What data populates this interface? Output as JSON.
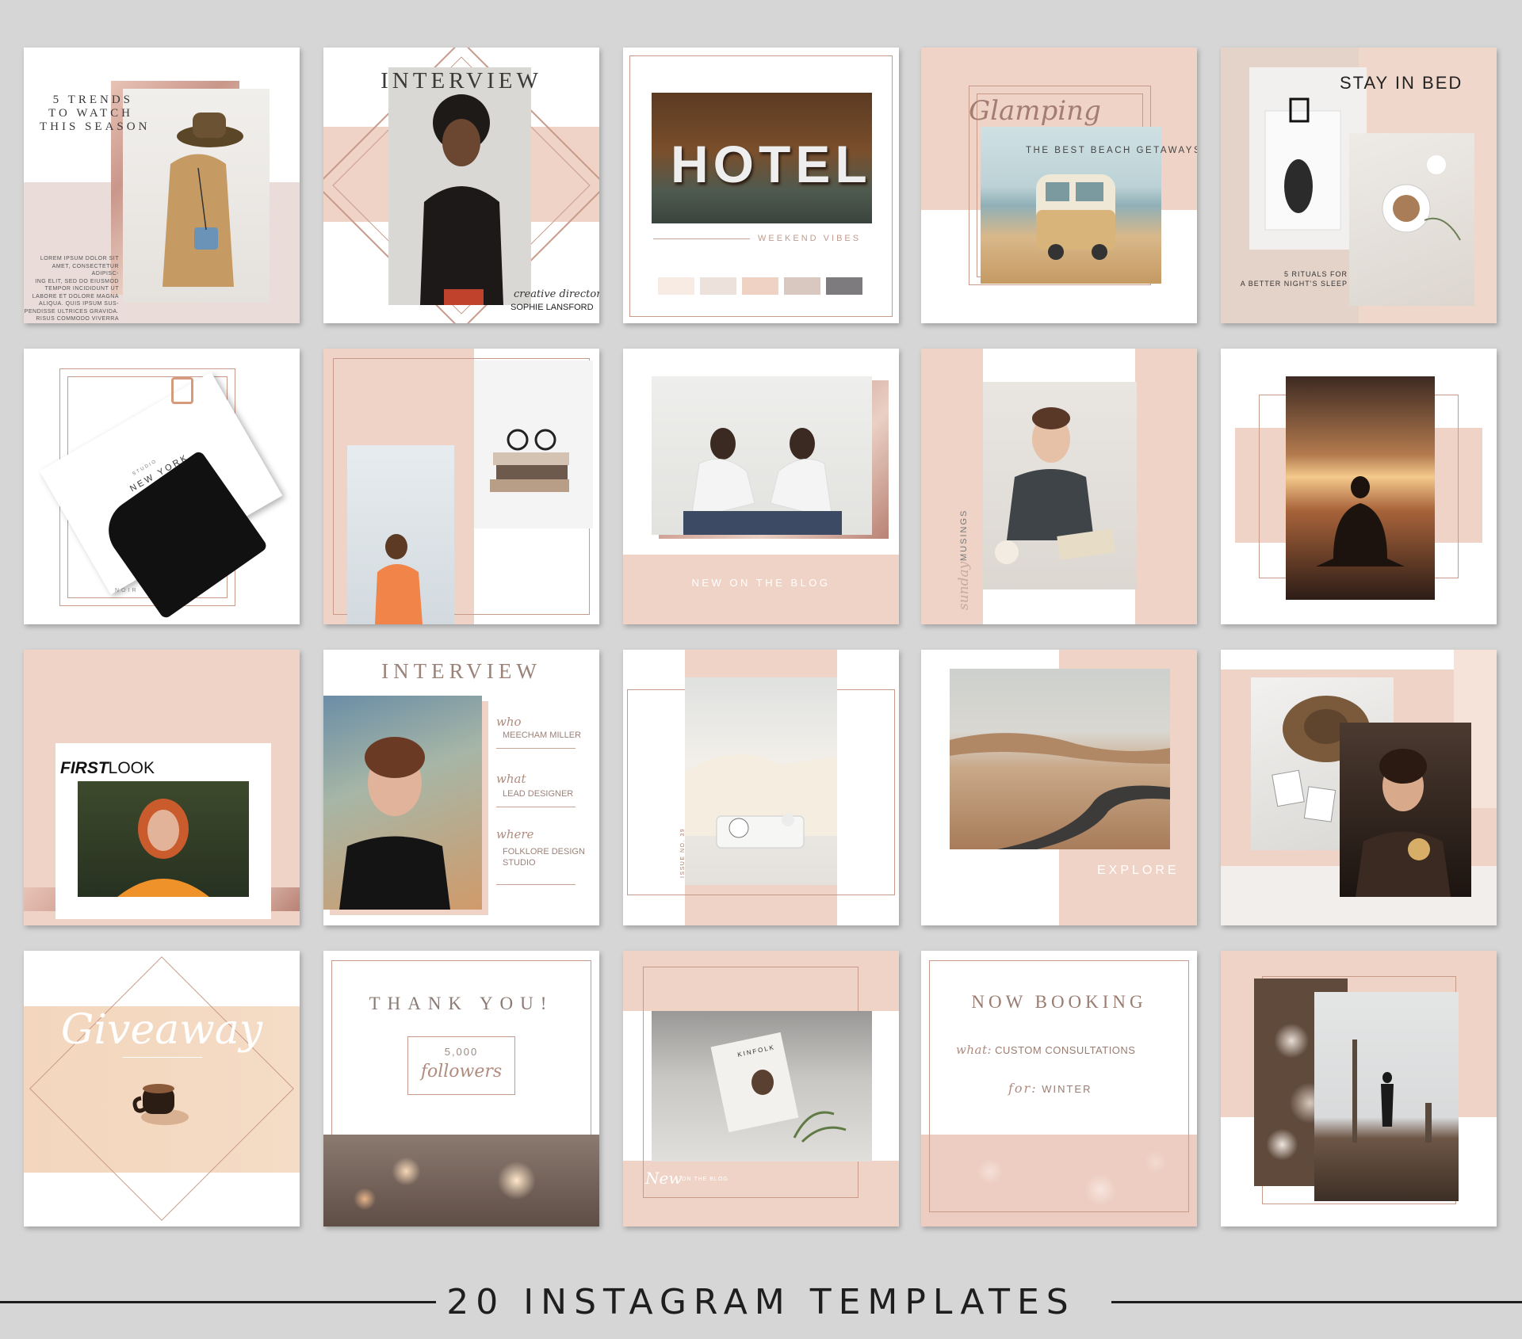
{
  "footer": {
    "title": "20 INSTAGRAM TEMPLATES"
  },
  "t1": {
    "heading_lines": [
      "5 TRENDS",
      "TO WATCH",
      "THIS SEASON"
    ],
    "body_lines": [
      "LOREM IPSUM DOLOR SIT",
      "AMET, CONSECTETUR ADIPISC-",
      "ING ELIT, SED DO EIUSMOD",
      "TEMPOR INCIDIDUNT UT",
      "LABORE ET DOLORE MAGNA",
      "ALIQUA. QUIS IPSUM SUS-",
      "PENDISSE ULTRICES GRAVIDA.",
      "RISUS COMMODO VIVERRA"
    ]
  },
  "t2": {
    "title": "INTERVIEW",
    "role": "creative director",
    "name": "SOPHIE LANSFORD"
  },
  "t3": {
    "sign": "HOTEL",
    "caption": "WEEKEND VIBES",
    "swatches": [
      "#f8ebe4",
      "#ede1dc",
      "#f0d2c4",
      "#d8c8bf",
      "#7d7b7d"
    ]
  },
  "t4": {
    "script": "Glamping",
    "caption": "THE BEST BEACH GETAWAYS"
  },
  "t5": {
    "title": "STAY IN BED",
    "caption_lines": [
      "5 RITUALS FOR",
      "A BETTER NIGHT'S SLEEP"
    ]
  },
  "t6": {
    "card_small": "STUDIO",
    "card_title": "NEW YORK",
    "card_footer": "NOIR"
  },
  "t8": {
    "caption": "NEW ON THE BLOG"
  },
  "t9": {
    "script": "sunday",
    "caption": "MUSINGS"
  },
  "t11": {
    "title_bold": "FIRST",
    "title_rest": "LOOK"
  },
  "t12": {
    "title": "INTERVIEW",
    "labels": [
      "who",
      "what",
      "where"
    ],
    "values": [
      "MEECHAM MILLER",
      "LEAD DESIGNER",
      "FOLKLORE DESIGN STUDIO"
    ]
  },
  "t13": {
    "issue": "ISSUE NO. 39"
  },
  "t14": {
    "caption": "EXPLORE"
  },
  "t16": {
    "script": "Giveaway"
  },
  "t17": {
    "title": "THANK YOU!",
    "count": "5,000",
    "script": "followers"
  },
  "t18": {
    "script": "New",
    "caption": "ON THE BLOG",
    "book": "KINFOLK"
  },
  "t19": {
    "title": "NOW BOOKING",
    "label1": "what:",
    "value1": "CUSTOM CONSULTATIONS",
    "label2": "for:",
    "value2": "WINTER"
  }
}
